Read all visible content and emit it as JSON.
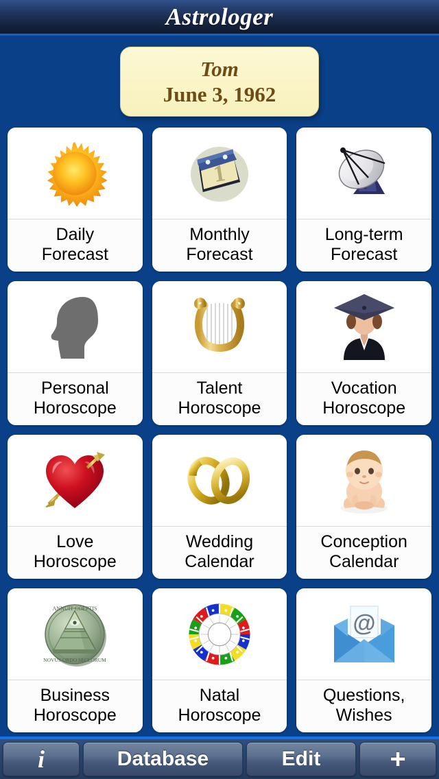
{
  "app": {
    "title": "Astrologer",
    "background_color": "#0a4088",
    "titlebar_color": "#121d35"
  },
  "person": {
    "name": "Tom",
    "birth_date": "June 3, 1962",
    "card_color": "#faf4c8",
    "text_color": "#6e4c15"
  },
  "grid": {
    "tiles": [
      {
        "icon": "sun-icon",
        "line1": "Daily",
        "line2": "Forecast"
      },
      {
        "icon": "calendar-icon",
        "line1": "Monthly",
        "line2": "Forecast"
      },
      {
        "icon": "satellite-dish-icon",
        "line1": "Long-term",
        "line2": "Forecast"
      },
      {
        "icon": "head-profile-icon",
        "line1": "Personal",
        "line2": "Horoscope"
      },
      {
        "icon": "lyre-icon",
        "line1": "Talent",
        "line2": "Horoscope"
      },
      {
        "icon": "graduate-icon",
        "line1": "Vocation",
        "line2": "Horoscope"
      },
      {
        "icon": "heart-arrow-icon",
        "line1": "Love",
        "line2": "Horoscope"
      },
      {
        "icon": "wedding-rings-icon",
        "line1": "Wedding",
        "line2": "Calendar"
      },
      {
        "icon": "baby-icon",
        "line1": "Conception",
        "line2": "Calendar"
      },
      {
        "icon": "coin-pyramid-icon",
        "line1": "Business",
        "line2": "Horoscope"
      },
      {
        "icon": "zodiac-wheel-icon",
        "line1": "Natal",
        "line2": "Horoscope"
      },
      {
        "icon": "envelope-at-icon",
        "line1": "Questions,",
        "line2": "Wishes"
      }
    ]
  },
  "toolbar": {
    "info_label": "i",
    "database_label": "Database",
    "edit_label": "Edit",
    "add_label": "+"
  }
}
